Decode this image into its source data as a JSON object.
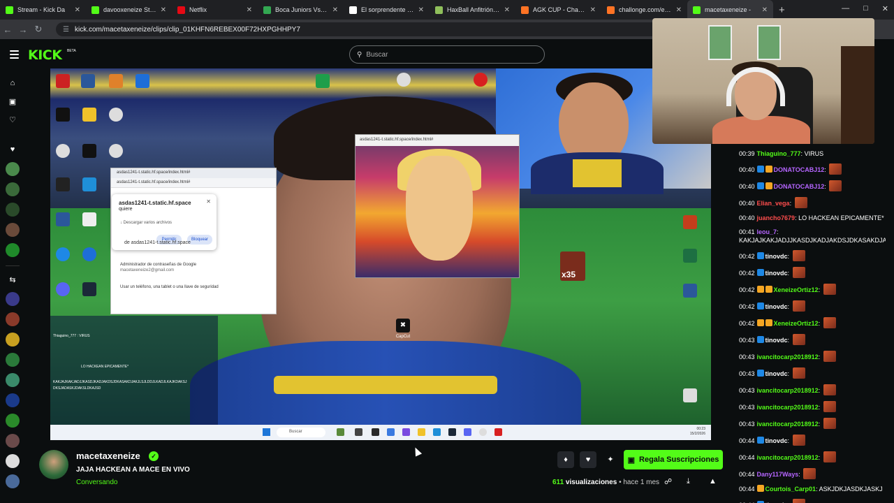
{
  "browser": {
    "tabs": [
      {
        "title": "Stream - Kick Da",
        "color": "#53fc18",
        "active": false
      },
      {
        "title": "davooxeneize Stream",
        "color": "#53fc18",
        "active": false
      },
      {
        "title": "Netflix",
        "color": "#e50914",
        "active": false
      },
      {
        "title": "Boca Juniors Vs Instit",
        "color": "#33a852",
        "active": false
      },
      {
        "title": "El sorprendente Hom",
        "color": "#ffffff",
        "active": false
      },
      {
        "title": "HaxBall Anfitrión sin",
        "color": "#8fbf5b",
        "active": false
      },
      {
        "title": "AGK CUP - Challonge",
        "color": "#ff7324",
        "active": false
      },
      {
        "title": "challonge.com/es/en",
        "color": "#ff7324",
        "active": false
      },
      {
        "title": "macetaxeneize -",
        "color": "#53fc18",
        "active": true
      }
    ],
    "url": "kick.com/macetaxeneize/clips/clip_01KHFN6REBEX00F72HXPGHHPY7"
  },
  "header": {
    "logo": "KICK",
    "beta": "BETA",
    "search_placeholder": "Buscar"
  },
  "video": {
    "popup_url": "asdas1241-t.static.hf.space/index.html#",
    "perm_title": "asdas1241-t.static.hf.space",
    "perm_sub": "quiere",
    "perm_action": "Descargar varios archivos",
    "perm_allow": "Permitir",
    "perm_block": "Bloquear",
    "pw_site": "de asdas1241-t.static.hf.space",
    "pw_manager": "Administrador de contraseñas de Google",
    "pw_email": "macetaxeneize2@gmail.com",
    "pw_key": "Usar un teléfono, una tablet o una llave de seguridad",
    "heman_url": "asdas1241-t.static.hf.space/index.html#",
    "taskbar_search": "Buscar",
    "taskbar_time": "00:23",
    "taskbar_date": "15/2/2026",
    "capcut": "CapCut",
    "emote_count": "x35",
    "overlay_lines": [
      "Thiaguino_777 : VIRUS",
      "LO HACKEAN EPICAMENTE*",
      "KAKJAJKAKJADJJKASDJKADJAKDSJDKASAKDJAKJLSJLDDJLKADJLKAJKDAKSJ",
      "DKSJADASKJDAKSLDKAJSD"
    ]
  },
  "chat": [
    {
      "time": "00:39",
      "user": "Thiaguino_777",
      "color": "#53fc18",
      "badges": [],
      "text": "VIRUS",
      "emote": false
    },
    {
      "time": "00:40",
      "user": "DONATOCABJ12",
      "color": "#b565ff",
      "badges": [
        "#1e88e5",
        "#f5a623"
      ],
      "text": "",
      "emote": true
    },
    {
      "time": "00:40",
      "user": "DONATOCABJ12",
      "color": "#b565ff",
      "badges": [
        "#1e88e5",
        "#f5a623"
      ],
      "text": "",
      "emote": true
    },
    {
      "time": "00:40",
      "user": "Elian_vega",
      "color": "#ff4d4d",
      "badges": [],
      "text": "",
      "emote": true
    },
    {
      "time": "00:40",
      "user": "juancho7679",
      "color": "#ff4d4d",
      "badges": [],
      "text": "LO HACKEAN EPICAMENTE*",
      "emote": false
    },
    {
      "time": "00:41",
      "user": "leou_7",
      "color": "#b565ff",
      "badges": [],
      "text": "KAKJAJKAKJADJJKASDJKADJAKDSJDKASAKDJAKJLSJLDDJLKADJLKAJKDAKSJSJADASKJDASKLDKAJSD",
      "emote": false
    },
    {
      "time": "00:42",
      "user": "tinovdc",
      "color": "#ffffff",
      "badges": [
        "#1e88e5"
      ],
      "text": "",
      "emote": true
    },
    {
      "time": "00:42",
      "user": "tinovdc",
      "color": "#ffffff",
      "badges": [
        "#1e88e5"
      ],
      "text": "",
      "emote": true
    },
    {
      "time": "00:42",
      "user": "XeneizeOrtiz12",
      "color": "#53fc18",
      "badges": [
        "#f5a623",
        "#f5a623"
      ],
      "text": "",
      "emote": true
    },
    {
      "time": "00:42",
      "user": "tinovdc",
      "color": "#ffffff",
      "badges": [
        "#1e88e5"
      ],
      "text": "",
      "emote": true
    },
    {
      "time": "00:42",
      "user": "XeneizeOrtiz12",
      "color": "#53fc18",
      "badges": [
        "#f5a623",
        "#f5a623"
      ],
      "text": "",
      "emote": true
    },
    {
      "time": "00:43",
      "user": "tinovdc",
      "color": "#ffffff",
      "badges": [
        "#1e88e5"
      ],
      "text": "",
      "emote": true
    },
    {
      "time": "00:43",
      "user": "ivancitocarp2018912",
      "color": "#53fc18",
      "badges": [],
      "text": "",
      "emote": true
    },
    {
      "time": "00:43",
      "user": "tinovdc",
      "color": "#ffffff",
      "badges": [
        "#1e88e5"
      ],
      "text": "",
      "emote": true
    },
    {
      "time": "00:43",
      "user": "ivancitocarp2018912",
      "color": "#53fc18",
      "badges": [],
      "text": "",
      "emote": true
    },
    {
      "time": "00:43",
      "user": "ivancitocarp2018912",
      "color": "#53fc18",
      "badges": [],
      "text": "",
      "emote": true
    },
    {
      "time": "00:43",
      "user": "ivancitocarp2018912",
      "color": "#53fc18",
      "badges": [],
      "text": "",
      "emote": true
    },
    {
      "time": "00:44",
      "user": "tinovdc",
      "color": "#ffffff",
      "badges": [
        "#1e88e5"
      ],
      "text": "",
      "emote": true
    },
    {
      "time": "00:44",
      "user": "ivancitocarp2018912",
      "color": "#53fc18",
      "badges": [],
      "text": "",
      "emote": true
    },
    {
      "time": "00:44",
      "user": "Dany117Ways",
      "color": "#b565ff",
      "badges": [],
      "text": "",
      "emote": true
    },
    {
      "time": "00:44",
      "user": "Courtois_Carp01",
      "color": "#53fc18",
      "badges": [
        "#f5a623"
      ],
      "text": "ASKJDKJASDKJASKJ",
      "emote": false
    },
    {
      "time": "00:44",
      "user": "tinovdc",
      "color": "#ffffff",
      "badges": [
        "#1e88e5"
      ],
      "text": "",
      "emote": true
    }
  ],
  "clip": {
    "channel": "macetaxeneize",
    "title": "JAJA HACKEAN A MACE EN VIVO",
    "category": "Conversando",
    "subscribe_label": "Regala Suscripciones",
    "views": "611",
    "views_label": "visualizaciones",
    "ago": "• hace 1 mes"
  },
  "colors": {
    "accent": "#53fc18",
    "bg": "#0b0e0f"
  }
}
